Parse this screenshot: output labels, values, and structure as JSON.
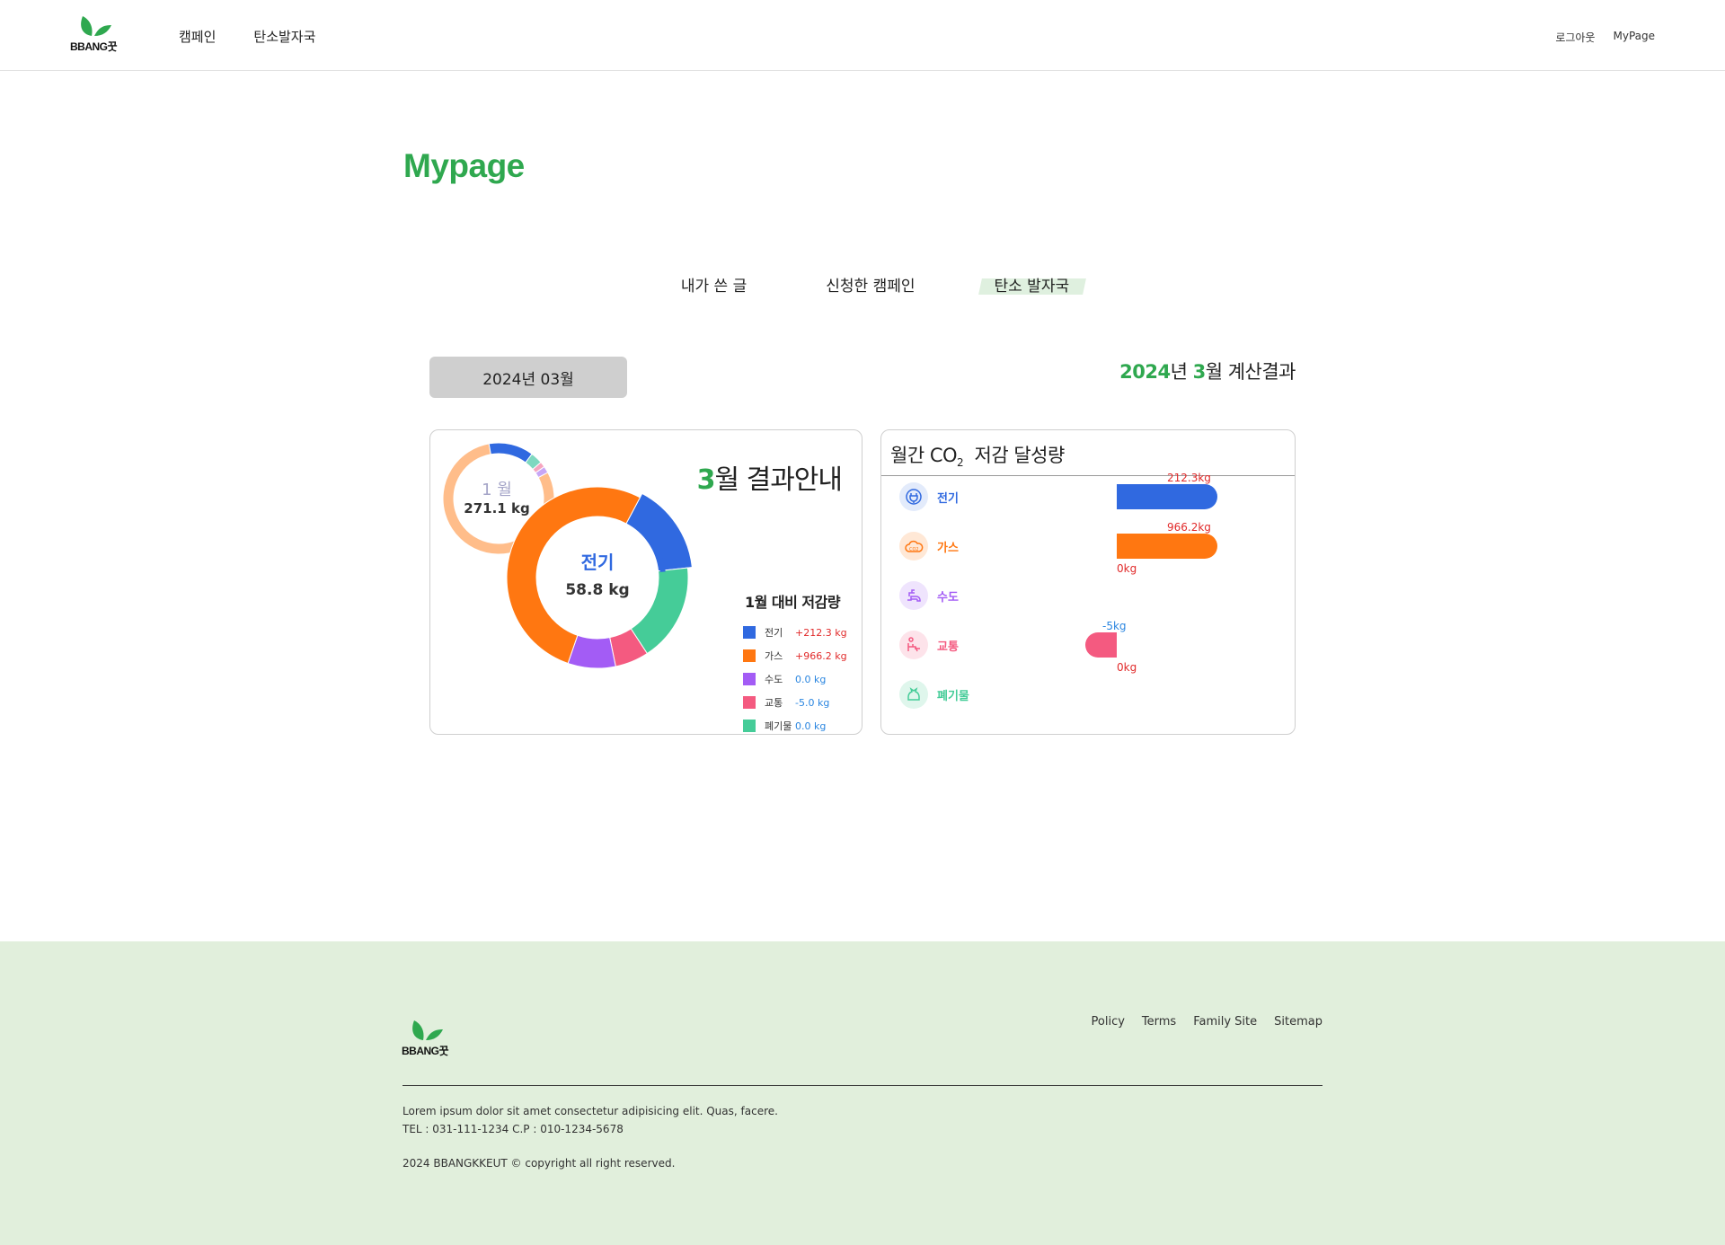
{
  "header": {
    "logo_text": "BBANG꿋",
    "nav": [
      "캠페인",
      "탄소발자국"
    ],
    "util": [
      "로그아웃",
      "MyPage"
    ]
  },
  "page": {
    "title": "Mypage",
    "tabs": [
      "내가 쓴 글",
      "신청한 캠페인",
      "탄소 발자국"
    ],
    "active_tab": "탄소 발자국",
    "month_select": "2024년 03월",
    "result_year": "2024",
    "result_year_suffix": "년 ",
    "result_month": "3",
    "result_suffix": "월 계산결과"
  },
  "left_card": {
    "title_num": "3",
    "title_text": "월 결과안내",
    "jan": {
      "month_label": "1 월",
      "total": "271.1 kg"
    },
    "mar": {
      "category": "전기",
      "value": "58.8 kg"
    },
    "legend_title": "1월 대비 저감량",
    "legend": [
      {
        "name": "전기",
        "value": "+212.3 kg",
        "sign": "pos",
        "color": "#3069e0"
      },
      {
        "name": "가스",
        "value": "+966.2 kg",
        "sign": "pos",
        "color": "#ff7711"
      },
      {
        "name": "수도",
        "value": "0.0 kg",
        "sign": "neg",
        "color": "#a35cf5"
      },
      {
        "name": "교통",
        "value": "-5.0 kg",
        "sign": "neg",
        "color": "#f45a80"
      },
      {
        "name": "폐기물",
        "value": "0.0 kg",
        "sign": "neg",
        "color": "#45cc98"
      }
    ]
  },
  "right_card": {
    "title": "월간 CO",
    "title_sub": "2",
    "title_rest": "저감 달성량",
    "categories": [
      {
        "name": "전기",
        "color": "#3069e0",
        "bg": "#e3ebfb",
        "icon": "plug-icon",
        "reduction": 212.3,
        "label": "212.3kg"
      },
      {
        "name": "가스",
        "color": "#ff7711",
        "bg": "#ffe8d6",
        "icon": "co2-cloud-icon",
        "reduction": 966.2,
        "label": "966.2kg"
      },
      {
        "name": "수도",
        "color": "#a35cf5",
        "bg": "#efe4fd",
        "icon": "faucet-icon",
        "reduction": 0,
        "label": "0kg"
      },
      {
        "name": "교통",
        "color": "#f45a80",
        "bg": "#fde3ea",
        "icon": "car-seat-icon",
        "reduction": -5,
        "label": "-5kg"
      },
      {
        "name": "폐기물",
        "color": "#45cc98",
        "bg": "#dff6ec",
        "icon": "trash-bag-icon",
        "reduction": 0,
        "label": "0kg"
      }
    ]
  },
  "chart_data": [
    {
      "type": "pie",
      "title": "",
      "center_label": "1 월 271.1 kg",
      "categories": [
        "가스",
        "전기",
        "폐기물",
        "교통",
        "수도"
      ],
      "values": [
        80,
        13,
        3.5,
        1.6,
        1.9
      ],
      "colors": [
        "#ffbd8a",
        "#3069e0",
        "#7fd8c0",
        "#f6a5bf",
        "#c8a6f6"
      ]
    },
    {
      "type": "pie",
      "title": "3월 결과안내",
      "center_label": "전기 58.8 kg",
      "categories": [
        "전기",
        "폐기물",
        "교통",
        "수도",
        "가스"
      ],
      "values": [
        15.5,
        17.5,
        6,
        8.5,
        52.5
      ],
      "colors": [
        "#3069e0",
        "#45cc98",
        "#f45a80",
        "#a35cf5",
        "#ff7711"
      ]
    },
    {
      "type": "bar",
      "title": "월간 CO2 저감 달성량",
      "categories": [
        "전기",
        "가스",
        "수도",
        "교통",
        "폐기물"
      ],
      "values": [
        212.3,
        966.2,
        0,
        -5,
        0
      ],
      "value_labels": [
        "212.3kg",
        "966.2kg",
        "0kg",
        "-5kg",
        "0kg"
      ],
      "colors": [
        "#3069e0",
        "#ff7711",
        "#a35cf5",
        "#f45a80",
        "#45cc98"
      ]
    }
  ],
  "footer": {
    "logo_text": "BBANG꿋",
    "links": [
      "Policy",
      "Terms",
      "Family Site",
      "Sitemap"
    ],
    "desc": "Lorem ipsum dolor sit amet consectetur adipisicing elit. Quas, facere.",
    "tel": "TEL : 031-111-1234 C.P : 010-1234-5678",
    "copyright": "2024 BBANGKKEUT © copyright all right reserved."
  }
}
